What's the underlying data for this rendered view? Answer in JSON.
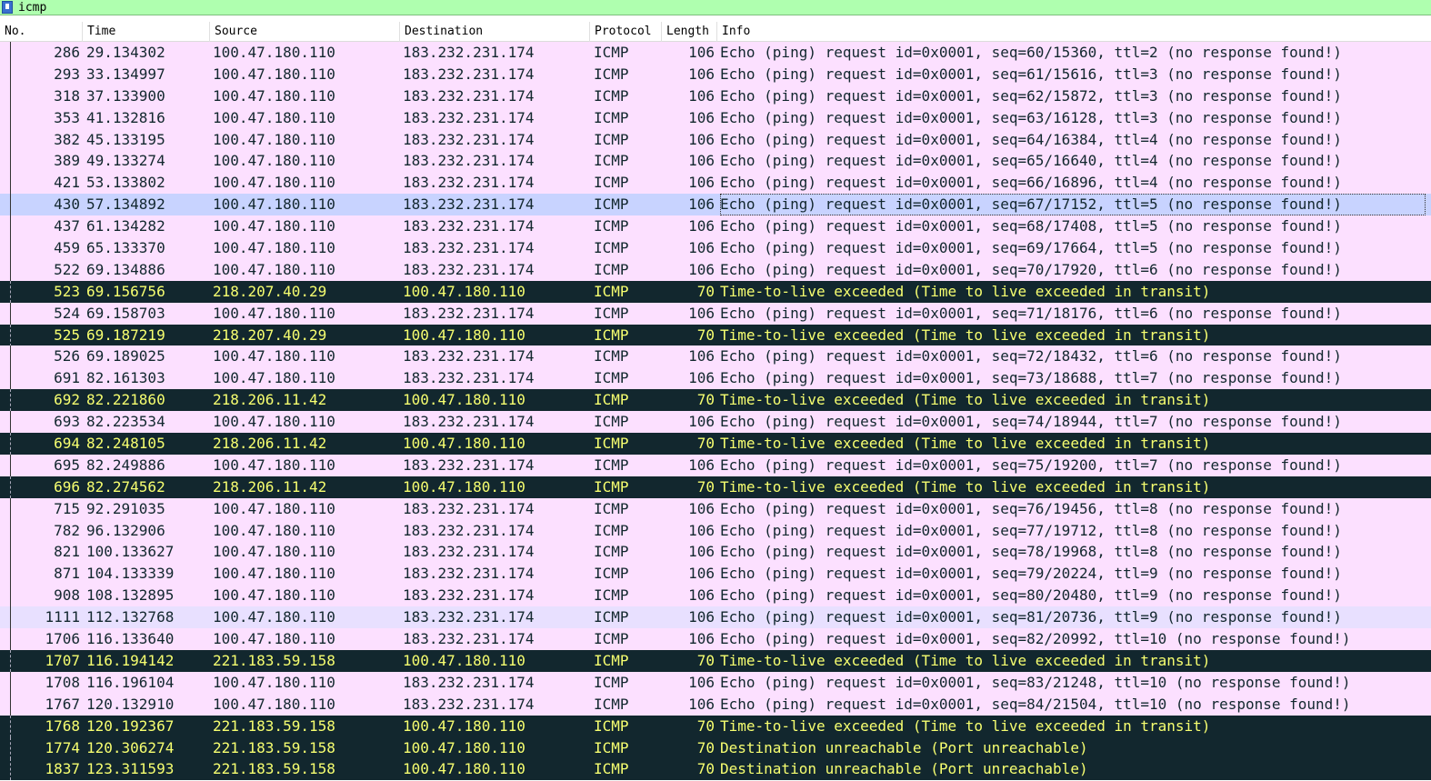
{
  "filter": {
    "value": "icmp"
  },
  "columns": [
    "No.",
    "Time",
    "Source",
    "Destination",
    "Protocol",
    "Length",
    "Info"
  ],
  "packets": [
    {
      "no": "286",
      "time": "29.134302",
      "src": "100.47.180.110",
      "dst": "183.232.231.174",
      "proto": "ICMP",
      "len": "106",
      "info": "Echo (ping) request  id=0x0001, seq=60/15360, ttl=2 (no response found!)",
      "type": "req"
    },
    {
      "no": "293",
      "time": "33.134997",
      "src": "100.47.180.110",
      "dst": "183.232.231.174",
      "proto": "ICMP",
      "len": "106",
      "info": "Echo (ping) request  id=0x0001, seq=61/15616, ttl=3 (no response found!)",
      "type": "req"
    },
    {
      "no": "318",
      "time": "37.133900",
      "src": "100.47.180.110",
      "dst": "183.232.231.174",
      "proto": "ICMP",
      "len": "106",
      "info": "Echo (ping) request  id=0x0001, seq=62/15872, ttl=3 (no response found!)",
      "type": "req"
    },
    {
      "no": "353",
      "time": "41.132816",
      "src": "100.47.180.110",
      "dst": "183.232.231.174",
      "proto": "ICMP",
      "len": "106",
      "info": "Echo (ping) request  id=0x0001, seq=63/16128, ttl=3 (no response found!)",
      "type": "req"
    },
    {
      "no": "382",
      "time": "45.133195",
      "src": "100.47.180.110",
      "dst": "183.232.231.174",
      "proto": "ICMP",
      "len": "106",
      "info": "Echo (ping) request  id=0x0001, seq=64/16384, ttl=4 (no response found!)",
      "type": "req"
    },
    {
      "no": "389",
      "time": "49.133274",
      "src": "100.47.180.110",
      "dst": "183.232.231.174",
      "proto": "ICMP",
      "len": "106",
      "info": "Echo (ping) request  id=0x0001, seq=65/16640, ttl=4 (no response found!)",
      "type": "req"
    },
    {
      "no": "421",
      "time": "53.133802",
      "src": "100.47.180.110",
      "dst": "183.232.231.174",
      "proto": "ICMP",
      "len": "106",
      "info": "Echo (ping) request  id=0x0001, seq=66/16896, ttl=4 (no response found!)",
      "type": "req"
    },
    {
      "no": "430",
      "time": "57.134892",
      "src": "100.47.180.110",
      "dst": "183.232.231.174",
      "proto": "ICMP",
      "len": "106",
      "info": "Echo (ping) request  id=0x0001, seq=67/17152, ttl=5 (no response found!)",
      "type": "sel"
    },
    {
      "no": "437",
      "time": "61.134282",
      "src": "100.47.180.110",
      "dst": "183.232.231.174",
      "proto": "ICMP",
      "len": "106",
      "info": "Echo (ping) request  id=0x0001, seq=68/17408, ttl=5 (no response found!)",
      "type": "req"
    },
    {
      "no": "459",
      "time": "65.133370",
      "src": "100.47.180.110",
      "dst": "183.232.231.174",
      "proto": "ICMP",
      "len": "106",
      "info": "Echo (ping) request  id=0x0001, seq=69/17664, ttl=5 (no response found!)",
      "type": "req"
    },
    {
      "no": "522",
      "time": "69.134886",
      "src": "100.47.180.110",
      "dst": "183.232.231.174",
      "proto": "ICMP",
      "len": "106",
      "info": "Echo (ping) request  id=0x0001, seq=70/17920, ttl=6 (no response found!)",
      "type": "req"
    },
    {
      "no": "523",
      "time": "69.156756",
      "src": "218.207.40.29",
      "dst": "100.47.180.110",
      "proto": "ICMP",
      "len": "70",
      "info": "Time-to-live exceeded (Time to live exceeded in transit)",
      "type": "ttl"
    },
    {
      "no": "524",
      "time": "69.158703",
      "src": "100.47.180.110",
      "dst": "183.232.231.174",
      "proto": "ICMP",
      "len": "106",
      "info": "Echo (ping) request  id=0x0001, seq=71/18176, ttl=6 (no response found!)",
      "type": "req"
    },
    {
      "no": "525",
      "time": "69.187219",
      "src": "218.207.40.29",
      "dst": "100.47.180.110",
      "proto": "ICMP",
      "len": "70",
      "info": "Time-to-live exceeded (Time to live exceeded in transit)",
      "type": "ttl"
    },
    {
      "no": "526",
      "time": "69.189025",
      "src": "100.47.180.110",
      "dst": "183.232.231.174",
      "proto": "ICMP",
      "len": "106",
      "info": "Echo (ping) request  id=0x0001, seq=72/18432, ttl=6 (no response found!)",
      "type": "req"
    },
    {
      "no": "691",
      "time": "82.161303",
      "src": "100.47.180.110",
      "dst": "183.232.231.174",
      "proto": "ICMP",
      "len": "106",
      "info": "Echo (ping) request  id=0x0001, seq=73/18688, ttl=7 (no response found!)",
      "type": "req"
    },
    {
      "no": "692",
      "time": "82.221860",
      "src": "218.206.11.42",
      "dst": "100.47.180.110",
      "proto": "ICMP",
      "len": "70",
      "info": "Time-to-live exceeded (Time to live exceeded in transit)",
      "type": "ttl"
    },
    {
      "no": "693",
      "time": "82.223534",
      "src": "100.47.180.110",
      "dst": "183.232.231.174",
      "proto": "ICMP",
      "len": "106",
      "info": "Echo (ping) request  id=0x0001, seq=74/18944, ttl=7 (no response found!)",
      "type": "req"
    },
    {
      "no": "694",
      "time": "82.248105",
      "src": "218.206.11.42",
      "dst": "100.47.180.110",
      "proto": "ICMP",
      "len": "70",
      "info": "Time-to-live exceeded (Time to live exceeded in transit)",
      "type": "ttl"
    },
    {
      "no": "695",
      "time": "82.249886",
      "src": "100.47.180.110",
      "dst": "183.232.231.174",
      "proto": "ICMP",
      "len": "106",
      "info": "Echo (ping) request  id=0x0001, seq=75/19200, ttl=7 (no response found!)",
      "type": "req"
    },
    {
      "no": "696",
      "time": "82.274562",
      "src": "218.206.11.42",
      "dst": "100.47.180.110",
      "proto": "ICMP",
      "len": "70",
      "info": "Time-to-live exceeded (Time to live exceeded in transit)",
      "type": "ttl"
    },
    {
      "no": "715",
      "time": "92.291035",
      "src": "100.47.180.110",
      "dst": "183.232.231.174",
      "proto": "ICMP",
      "len": "106",
      "info": "Echo (ping) request  id=0x0001, seq=76/19456, ttl=8 (no response found!)",
      "type": "req"
    },
    {
      "no": "782",
      "time": "96.132906",
      "src": "100.47.180.110",
      "dst": "183.232.231.174",
      "proto": "ICMP",
      "len": "106",
      "info": "Echo (ping) request  id=0x0001, seq=77/19712, ttl=8 (no response found!)",
      "type": "req"
    },
    {
      "no": "821",
      "time": "100.133627",
      "src": "100.47.180.110",
      "dst": "183.232.231.174",
      "proto": "ICMP",
      "len": "106",
      "info": "Echo (ping) request  id=0x0001, seq=78/19968, ttl=8 (no response found!)",
      "type": "req"
    },
    {
      "no": "871",
      "time": "104.133339",
      "src": "100.47.180.110",
      "dst": "183.232.231.174",
      "proto": "ICMP",
      "len": "106",
      "info": "Echo (ping) request  id=0x0001, seq=79/20224, ttl=9 (no response found!)",
      "type": "req"
    },
    {
      "no": "908",
      "time": "108.132895",
      "src": "100.47.180.110",
      "dst": "183.232.231.174",
      "proto": "ICMP",
      "len": "106",
      "info": "Echo (ping) request  id=0x0001, seq=80/20480, ttl=9 (no response found!)",
      "type": "req"
    },
    {
      "no": "1111",
      "time": "112.132768",
      "src": "100.47.180.110",
      "dst": "183.232.231.174",
      "proto": "ICMP",
      "len": "106",
      "info": "Echo (ping) request  id=0x0001, seq=81/20736, ttl=9 (no response found!)",
      "type": "hov"
    },
    {
      "no": "1706",
      "time": "116.133640",
      "src": "100.47.180.110",
      "dst": "183.232.231.174",
      "proto": "ICMP",
      "len": "106",
      "info": "Echo (ping) request  id=0x0001, seq=82/20992, ttl=10 (no response found!)",
      "type": "req"
    },
    {
      "no": "1707",
      "time": "116.194142",
      "src": "221.183.59.158",
      "dst": "100.47.180.110",
      "proto": "ICMP",
      "len": "70",
      "info": "Time-to-live exceeded (Time to live exceeded in transit)",
      "type": "ttl"
    },
    {
      "no": "1708",
      "time": "116.196104",
      "src": "100.47.180.110",
      "dst": "183.232.231.174",
      "proto": "ICMP",
      "len": "106",
      "info": "Echo (ping) request  id=0x0001, seq=83/21248, ttl=10 (no response found!)",
      "type": "req"
    },
    {
      "no": "1767",
      "time": "120.132910",
      "src": "100.47.180.110",
      "dst": "183.232.231.174",
      "proto": "ICMP",
      "len": "106",
      "info": "Echo (ping) request  id=0x0001, seq=84/21504, ttl=10 (no response found!)",
      "type": "req"
    },
    {
      "no": "1768",
      "time": "120.192367",
      "src": "221.183.59.158",
      "dst": "100.47.180.110",
      "proto": "ICMP",
      "len": "70",
      "info": "Time-to-live exceeded (Time to live exceeded in transit)",
      "type": "ttl"
    },
    {
      "no": "1774",
      "time": "120.306274",
      "src": "221.183.59.158",
      "dst": "100.47.180.110",
      "proto": "ICMP",
      "len": "70",
      "info": "Destination unreachable (Port unreachable)",
      "type": "ttl"
    },
    {
      "no": "1837",
      "time": "123.311593",
      "src": "221.183.59.158",
      "dst": "100.47.180.110",
      "proto": "ICMP",
      "len": "70",
      "info": "Destination unreachable (Port unreachable)",
      "type": "ttl"
    }
  ],
  "colors": {
    "filter_bg": "#afffaf",
    "request_bg": "#fce0ff",
    "request_fg": "#12272e",
    "error_bg": "#12272e",
    "error_fg": "#f7ff70",
    "selected_bg": "#c8d3ff"
  }
}
